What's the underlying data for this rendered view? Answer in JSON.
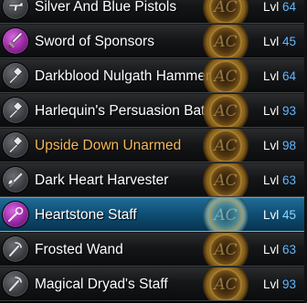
{
  "inventory": {
    "badge_text": "AC",
    "level_label": "Lvl",
    "colors": {
      "row_background": "#151618",
      "selected_background": "#0f4e74",
      "level_number": "#5fb8ff",
      "rare_name": "#f4b85a",
      "normal_name": "#ffffff"
    },
    "items": [
      {
        "name": "Silver And Blue Pistols",
        "level": "64",
        "icon": "pistol-icon",
        "selected": false,
        "rare": false
      },
      {
        "name": "Sword of Sponsors",
        "level": "45",
        "icon": "sword-icon",
        "selected": false,
        "rare": false
      },
      {
        "name": "Darkblood Nulgath Hammer",
        "level": "64",
        "icon": "hammer-icon",
        "selected": false,
        "rare": false
      },
      {
        "name": "Harlequin's Persuasion Bat",
        "level": "93",
        "icon": "mace-icon",
        "selected": false,
        "rare": false
      },
      {
        "name": "Upside Down Unarmed",
        "level": "98",
        "icon": "fist-icon",
        "selected": false,
        "rare": true
      },
      {
        "name": "Dark Heart Harvester",
        "level": "63",
        "icon": "axe-icon",
        "selected": false,
        "rare": false
      },
      {
        "name": "Heartstone Staff",
        "level": "45",
        "icon": "staff-icon",
        "selected": true,
        "rare": false
      },
      {
        "name": "Frosted Wand",
        "level": "63",
        "icon": "wand-icon",
        "selected": false,
        "rare": false
      },
      {
        "name": "Magical Dryad's Staff",
        "level": "93",
        "icon": "staff-icon",
        "selected": false,
        "rare": false
      }
    ]
  }
}
